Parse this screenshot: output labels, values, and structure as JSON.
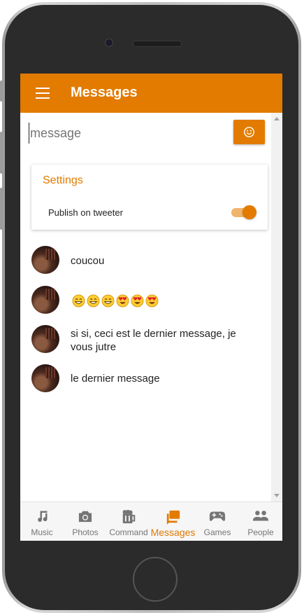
{
  "app": {
    "title": "Messages",
    "accent": "#e27b00"
  },
  "composer": {
    "placeholder": "message",
    "emoji_button_icon": "smiley-icon"
  },
  "settings": {
    "title": "Settings",
    "publish_label": "Publish on tweeter",
    "publish_enabled": true
  },
  "messages": [
    {
      "text": "coucou"
    },
    {
      "text": "",
      "emojis": [
        "grinning",
        "grinning",
        "grinning",
        "heart-eyes",
        "heart-eyes",
        "heart-eyes"
      ]
    },
    {
      "text": "si si, ceci est le dernier message, je vous jutre"
    },
    {
      "text": "le dernier message"
    }
  ],
  "nav": [
    {
      "label": "Music",
      "icon": "music-note-icon",
      "active": false
    },
    {
      "label": "Photos",
      "icon": "camera-icon",
      "active": false
    },
    {
      "label": "Command",
      "icon": "beer-mug-icon",
      "active": false
    },
    {
      "label": "Messages",
      "icon": "chat-icon",
      "active": true
    },
    {
      "label": "Games",
      "icon": "gamepad-icon",
      "active": false
    },
    {
      "label": "People",
      "icon": "people-icon",
      "active": false
    }
  ]
}
